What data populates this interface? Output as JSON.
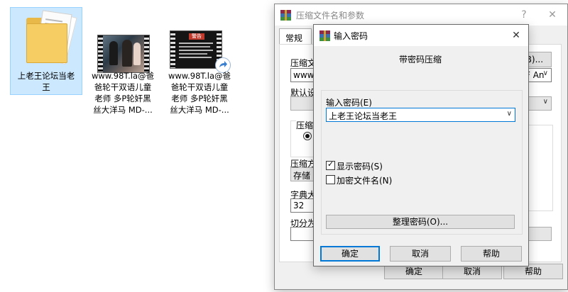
{
  "desktop": {
    "files": [
      {
        "name": "上老王论坛当老王",
        "line1": "上老王论坛当老",
        "line2": "王",
        "type": "folder",
        "selected": true
      },
      {
        "name": "www.98T.la@爸爸轮干双语儿童老师 多P轮奸黑丝大洋马 MD-...",
        "line1": "www.98T.la@爸",
        "line2": "爸轮干双语儿童",
        "line3": "老师 多P轮奸黑",
        "line4": "丝大洋马 MD-...",
        "type": "video"
      },
      {
        "name": "www.98T.la@爸爸轮干双语儿童老师 多P轮奸黑丝大洋马 MD-...",
        "line1": "www.98T.la@爸",
        "line2": "爸轮干双语儿童",
        "line3": "老师 多P轮奸黑",
        "line4": "丝大洋马 MD-...",
        "type": "video",
        "thumb_text": "警告",
        "badge_icon": "shortcut-arrow-icon"
      }
    ]
  },
  "archive_dialog": {
    "title": "压缩文件名和参数",
    "help_glyph": "?",
    "close_glyph": "✕",
    "tab_general": "常规",
    "archive_name_label": "压缩文",
    "archive_name_value": "www.9",
    "browse_label": "(B)...",
    "update_mode_value": "F An",
    "default_profile_label": "默认设",
    "archive_format_label": "压缩",
    "compression_method_label": "压缩方",
    "compression_method_value": "存储",
    "dictionary_label": "字典大",
    "dictionary_value": "32",
    "split_label": "切分为",
    "ok_label": "确定",
    "cancel_label": "取消",
    "help_label": "帮助"
  },
  "password_dialog": {
    "title": "输入密码",
    "close_glyph": "✕",
    "heading": "带密码压缩",
    "enter_password_label": "输入密码(E)",
    "password_value": "上老王论坛当老王",
    "show_password_label": "显示密码(S)",
    "show_password_checked": true,
    "encrypt_filenames_label": "加密文件名(N)",
    "encrypt_filenames_checked": false,
    "organize_button": "整理密码(O)...",
    "ok_label": "确定",
    "cancel_label": "取消",
    "help_label": "帮助"
  },
  "colors": {
    "focus_blue": "#0078d7",
    "selection_bg": "#cce8ff",
    "folder_yellow": "#f6cd62"
  }
}
